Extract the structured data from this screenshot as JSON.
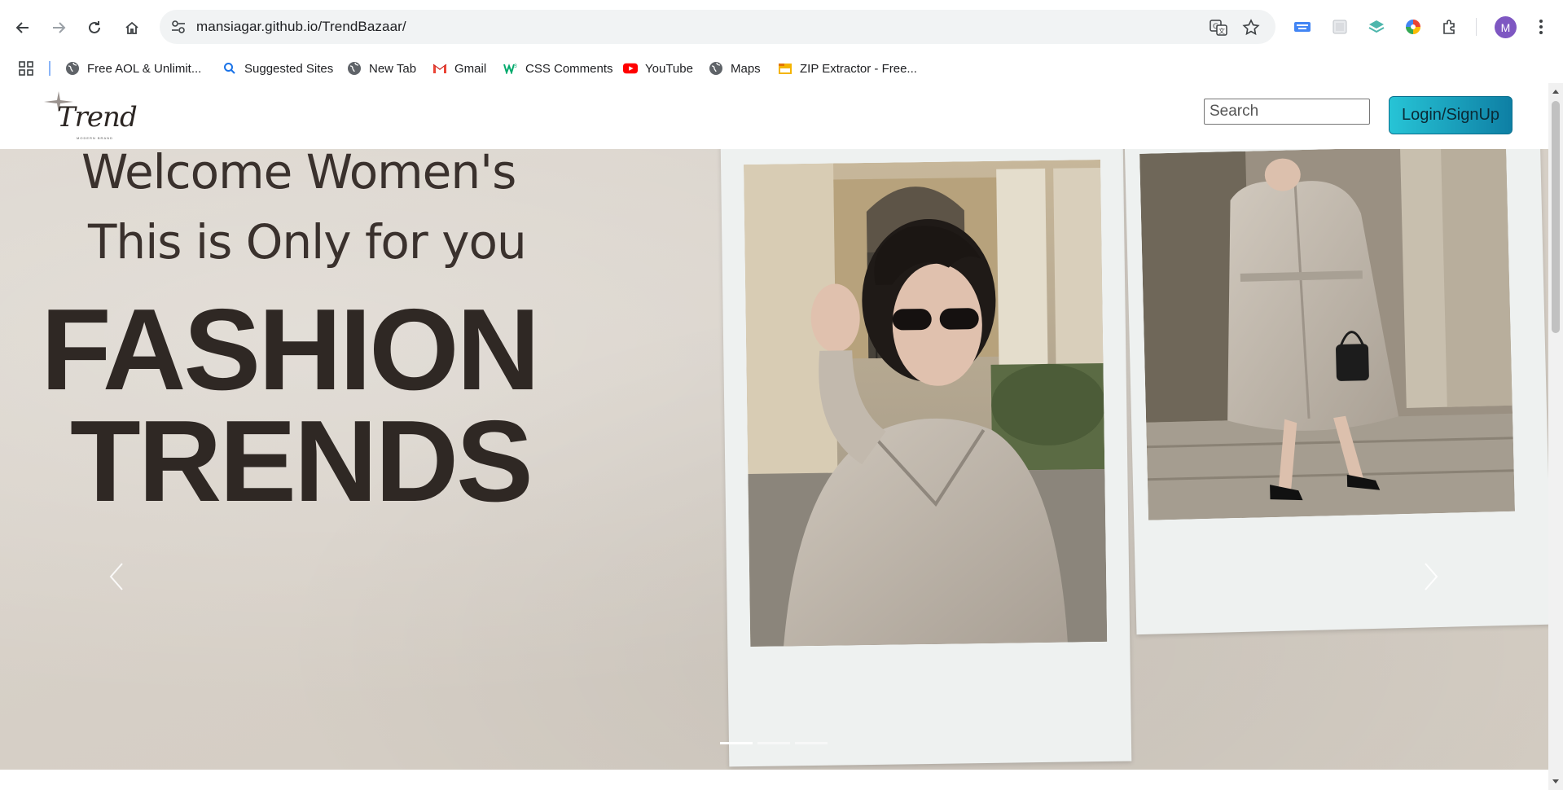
{
  "browser": {
    "url": "mansiagar.github.io/TrendBazaar/",
    "profile_initial": "M",
    "bookmarks": [
      {
        "label": "Free AOL & Unlimit...",
        "icon": "globe-icon"
      },
      {
        "label": "Suggested Sites",
        "icon": "search-icon"
      },
      {
        "label": "New Tab",
        "icon": "globe-icon"
      },
      {
        "label": "Gmail",
        "icon": "gmail-icon"
      },
      {
        "label": "CSS Comments",
        "icon": "w3-icon"
      },
      {
        "label": "YouTube",
        "icon": "youtube-icon"
      },
      {
        "label": "Maps",
        "icon": "globe-icon"
      },
      {
        "label": "ZIP Extractor - Free...",
        "icon": "zip-icon"
      }
    ]
  },
  "header": {
    "logo_text": "Trend",
    "logo_sub": "MODERN BRAND",
    "search_placeholder": "Search",
    "login_label": "Login/SignUp",
    "accent_start": "#27c4d6",
    "accent_end": "#0e7fa4"
  },
  "hero": {
    "line1": "Welcome Women's",
    "line2": "This is Only for you",
    "line3": "FASHION",
    "line4": "TRENDS",
    "slide_count": 3,
    "active_slide": 1
  }
}
